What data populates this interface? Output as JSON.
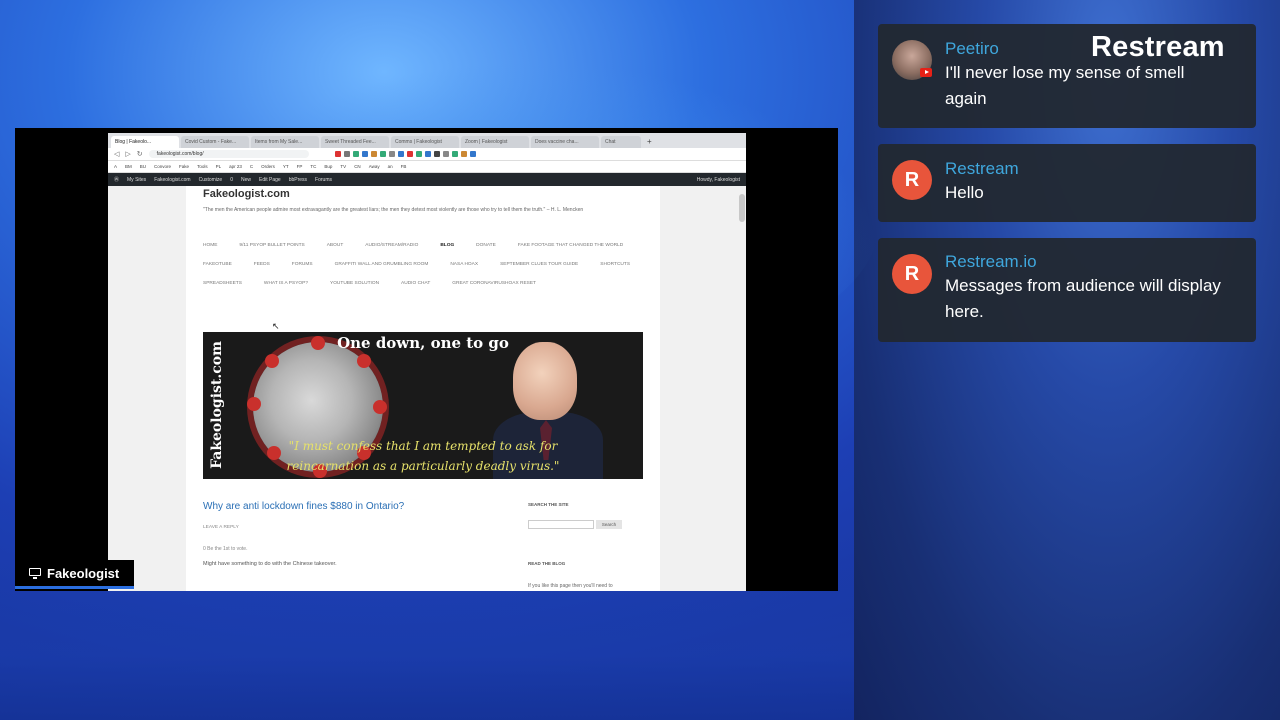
{
  "shared_screen": {
    "label": "Fakeologist",
    "browser": {
      "tabs": [
        "Blog | Fakeolo...",
        "Covid Custom - Fake...",
        "Items from My Sale...",
        "Sweet Threaded Fee...",
        "Comms | Fakeologist",
        "Zoom | Fakeologist",
        "Does vaccine cha...",
        "Chat"
      ],
      "url": "fakeologist.com/blog/",
      "bookmarks": [
        "A",
        "BM",
        "BU",
        "Convore",
        "Fake",
        "Tools",
        "PL",
        "apr 23",
        "C",
        "Orders",
        "YT",
        "FP",
        "TC",
        "Bup",
        "TV",
        "CN",
        "Away",
        "an",
        "FB"
      ],
      "wp_admin": [
        "My Sites",
        "Fakeologist.com",
        "Customize",
        "0",
        "New",
        "Edit Page",
        "bbPress",
        "Forums"
      ],
      "wp_howdy": "Howdy, Fakeologist",
      "site_title": "Fakeologist.com",
      "tagline": "\"The men the American people admire most extravagantly are the greatest liars; the men they detest most violently are those who try to tell them the truth.\" – H. L. Mencken",
      "menu": [
        "HOME",
        "9/11 PSYOP BULLET POINTS",
        "ABOUT",
        "AUDIO/STREAM/RADIO",
        "BLOG",
        "DONATE",
        "FAKE FOOTAGE THAT CHANGED THE WORLD",
        "FAKEOTUBE",
        "FEEDS",
        "FORUMS",
        "GRAFFITI WALL AND GRUMBLING ROOM",
        "NASA HOAX",
        "SEPTEMBER CLUES TOUR GUIDE",
        "SHORTCUTS",
        "SPREADSHEETS",
        "WHAT IS A PSYOP?",
        "YOUTUBE SOLUTION",
        "AUDIO CHAT",
        "GREAT CORONAVIRUSHOAX RESET"
      ],
      "banner": {
        "brand": "Fakeologist.com",
        "headline": "One down, one to go",
        "quote": "\"I must confess that I am tempted to ask for reincarnation as a particularly deadly virus.\""
      },
      "post_title": "Why are anti lockdown fines $880 in Ontario?",
      "leave_reply": "LEAVE A REPLY",
      "rating": "0   Be the 1st to vote.",
      "excerpt": "Might have something to do with the Chinese takeover.",
      "sidebar": {
        "search_heading": "SEARCH THE SITE",
        "search_button": "Search",
        "read_heading": "READ THE BLOG",
        "read_text": "If you like this page then you'll need to"
      }
    }
  },
  "chat": [
    {
      "name": "Peetiro",
      "message": "I'll never lose my sense of smell again",
      "avatar": "user",
      "platform": "youtube"
    },
    {
      "name": "Restream",
      "message": "Hello",
      "avatar": "R"
    },
    {
      "name": "Restream.io",
      "message": "Messages from audience will display here.",
      "avatar": "R"
    }
  ],
  "brand": "Restream",
  "colors": {
    "chat_name": "#3fa7dd",
    "restream_orange": "#e8553b",
    "panel_bg": "#222830",
    "youtube_red": "#e62117"
  }
}
